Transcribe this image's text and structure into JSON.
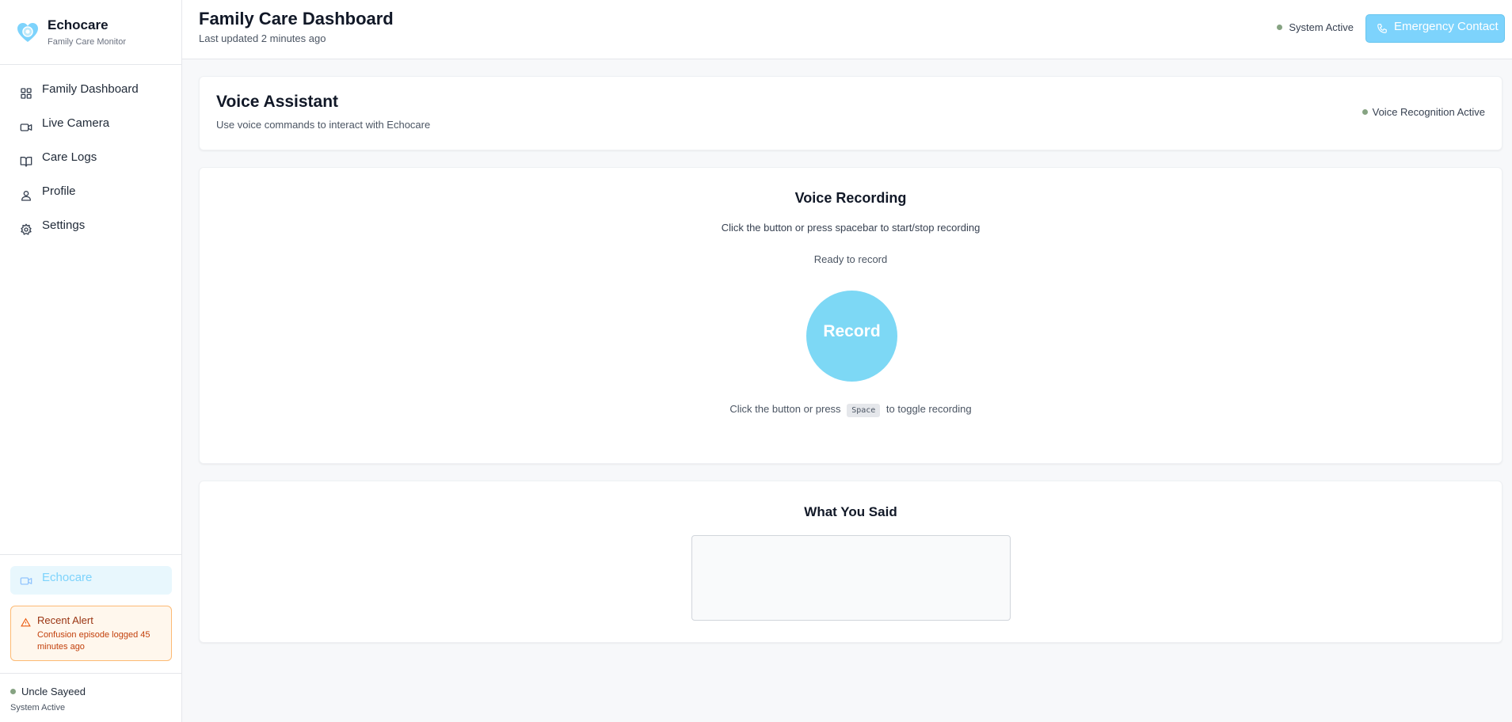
{
  "brand": {
    "name": "Echocare",
    "subtitle": "Family Care Monitor"
  },
  "nav": [
    {
      "label": "Family Dashboard",
      "icon": "grid-icon"
    },
    {
      "label": "Live Camera",
      "icon": "video-icon"
    },
    {
      "label": "Care Logs",
      "icon": "book-icon"
    },
    {
      "label": "Profile",
      "icon": "user-icon"
    },
    {
      "label": "Settings",
      "icon": "gear-icon"
    }
  ],
  "sidebar_active": {
    "label": "Echocare",
    "icon": "video-icon"
  },
  "alert": {
    "title": "Recent Alert",
    "text": "Confusion episode logged 45 minutes ago",
    "icon": "warning-icon"
  },
  "user": {
    "name": "Uncle Sayeed",
    "status": "System Active"
  },
  "header": {
    "title": "Family Care Dashboard",
    "subtitle": "Last updated 2 minutes ago",
    "system_status": "System Active",
    "emergency_label": "Emergency Contact"
  },
  "assistant": {
    "title": "Voice Assistant",
    "subtitle": "Use voice commands to interact with Echocare",
    "status": "Voice Recognition Active"
  },
  "recording": {
    "title": "Voice Recording",
    "instruction": "Click the button or press spacebar to start/stop recording",
    "status": "Ready to record",
    "button_label": "Record",
    "hint_before": "Click the button or press",
    "hint_key": "Space",
    "hint_after": "to toggle recording"
  },
  "transcript": {
    "title": "What You Said",
    "text": ""
  },
  "colors": {
    "accent": "#7dd3fc",
    "status_dot": "#86a382",
    "alert_border": "#fdba74",
    "alert_bg": "#fff7ed"
  }
}
